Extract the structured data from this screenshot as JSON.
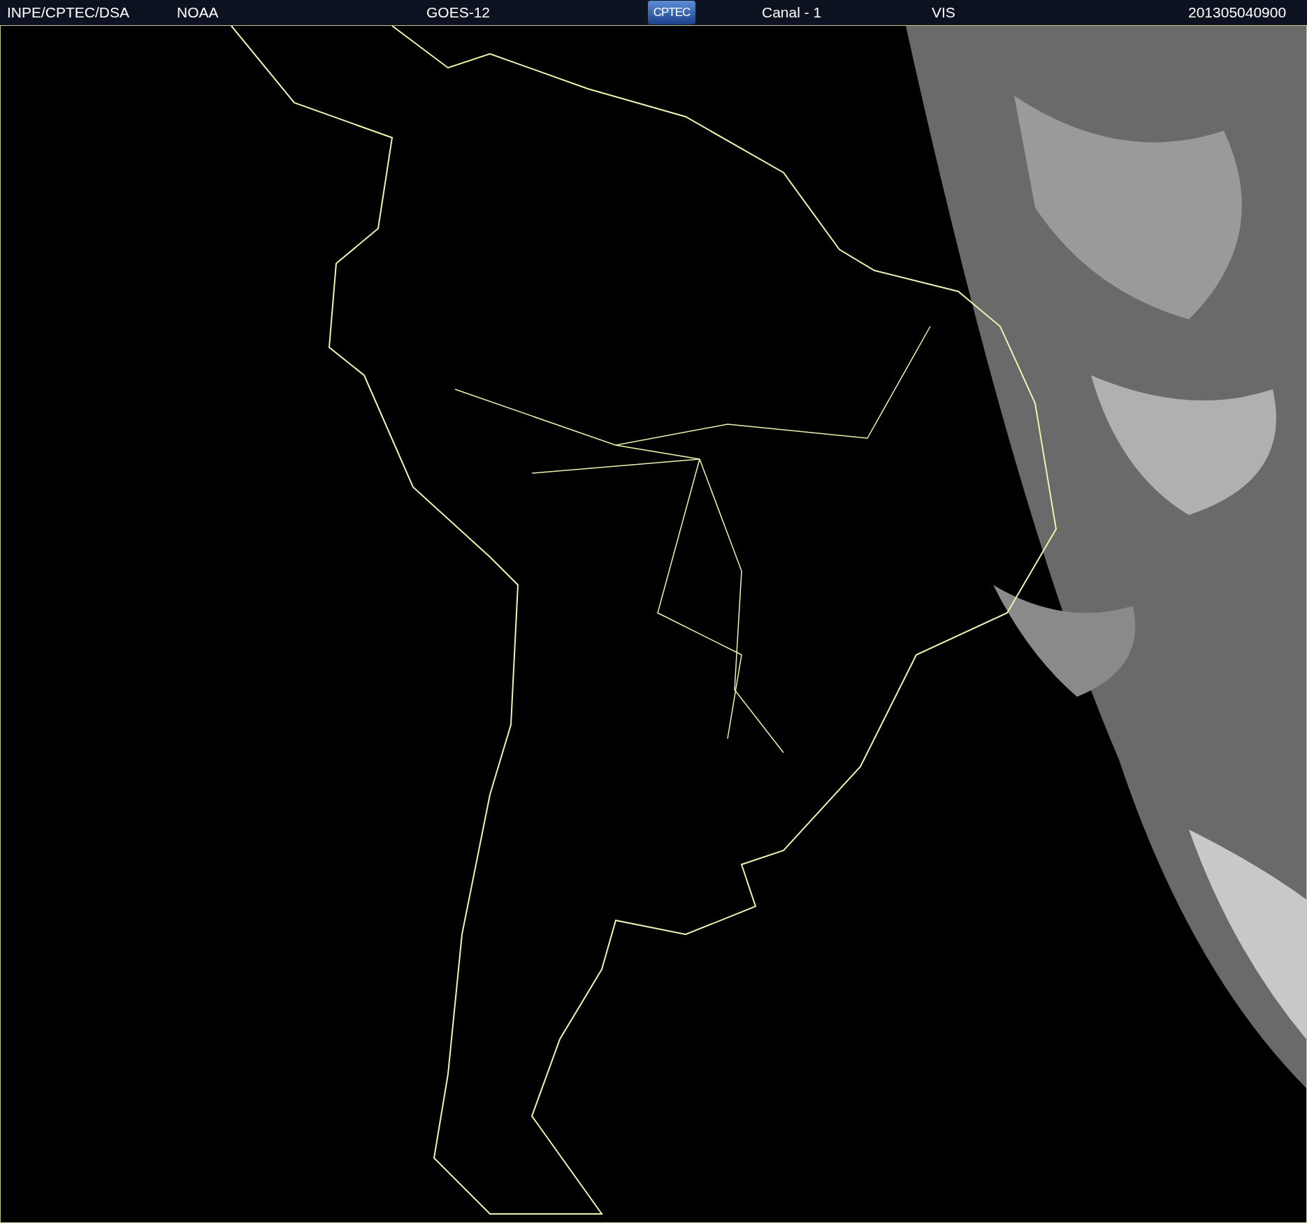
{
  "header": [
    {
      "kind": "text",
      "text": "INPE/CPTEC/DSA"
    },
    {
      "kind": "text",
      "text": "NOAA"
    },
    {
      "kind": "text",
      "text": "GOES-12"
    },
    {
      "kind": "logo",
      "text": "CPTEC"
    },
    {
      "kind": "text",
      "text": "Canal - 1"
    },
    {
      "kind": "text",
      "text": "VIS"
    },
    {
      "kind": "text",
      "text": "201305040900"
    }
  ]
}
